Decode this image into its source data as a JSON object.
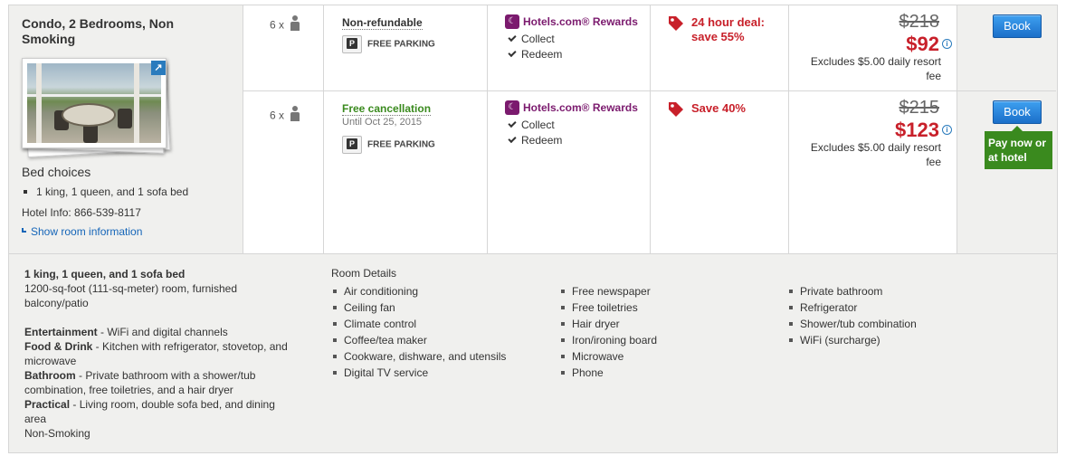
{
  "room": {
    "title": "Condo, 2 Bedrooms, Non Smoking",
    "bed_choices_heading": "Bed choices",
    "bed_choice": "1 king, 1 queen, and 1 sofa bed",
    "hotel_info": "Hotel Info: 866-539-8117",
    "show_room_info": "Show room information"
  },
  "rates": [
    {
      "occupancy": "6 x",
      "policy": "Non-refundable",
      "policy_sub": "",
      "parking": "FREE PARKING",
      "rewards_title": "Hotels.com® Rewards",
      "collect": "Collect",
      "redeem": "Redeem",
      "deal": "24 hour deal: save 55%",
      "old_price": "$218",
      "price": "$92",
      "fee": "Excludes $5.00 daily resort fee",
      "book": "Book"
    },
    {
      "occupancy": "6 x",
      "policy": "Free cancellation",
      "policy_sub": "Until Oct 25, 2015",
      "parking": "FREE PARKING",
      "rewards_title": "Hotels.com® Rewards",
      "collect": "Collect",
      "redeem": "Redeem",
      "deal": "Save 40%",
      "old_price": "$215",
      "price": "$123",
      "fee": "Excludes $5.00 daily resort fee",
      "book": "Book",
      "pay_option": "Pay now or at hotel"
    }
  ],
  "details": {
    "bed_line": "1 king, 1 queen, and 1 sofa bed",
    "size_line": "1200-sq-foot (111-sq-meter) room, furnished balcony/patio",
    "entertainment_label": "Entertainment",
    "entertainment_text": " - WiFi and digital channels",
    "food_label": "Food & Drink",
    "food_text": " - Kitchen with refrigerator, stovetop, and microwave",
    "bathroom_label": "Bathroom",
    "bathroom_text": " - Private bathroom with a shower/tub combination, free toiletries, and a hair dryer",
    "practical_label": "Practical",
    "practical_text": " - Living room, double sofa bed, and dining area",
    "smoking": "Non-Smoking",
    "room_details_heading": "Room Details",
    "amenities_col1": [
      "Air conditioning",
      "Ceiling fan",
      "Climate control",
      "Coffee/tea maker",
      "Cookware, dishware, and utensils",
      "Digital TV service"
    ],
    "amenities_col2": [
      "Free newspaper",
      "Free toiletries",
      "Hair dryer",
      "Iron/ironing board",
      "Microwave",
      "Phone"
    ],
    "amenities_col3": [
      "Private bathroom",
      "Refrigerator",
      "Shower/tub combination",
      "WiFi (surcharge)"
    ]
  },
  "colors": {
    "accent_red": "#c8202a",
    "rewards_purple": "#7b1a6e",
    "link_blue": "#1565b8",
    "green": "#3a8a1e",
    "button_blue": "#1b6fc9"
  },
  "icons": [
    "person-icon",
    "parking-icon",
    "rewards-icon",
    "check-icon",
    "price-tag-icon",
    "info-icon",
    "expand-icon"
  ]
}
